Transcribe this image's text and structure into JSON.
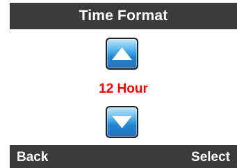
{
  "header": {
    "title": "Time Format"
  },
  "selector": {
    "up_icon": "triangle-up-icon",
    "down_icon": "triangle-down-icon",
    "current_value": "12 Hour",
    "value_color": "#ff0000"
  },
  "softkeys": {
    "left_label": "Back",
    "right_label": "Select"
  },
  "colors": {
    "bar_background": "#3b3b3b",
    "bar_text": "#ffffff",
    "button_blue": "#1d86d4"
  }
}
